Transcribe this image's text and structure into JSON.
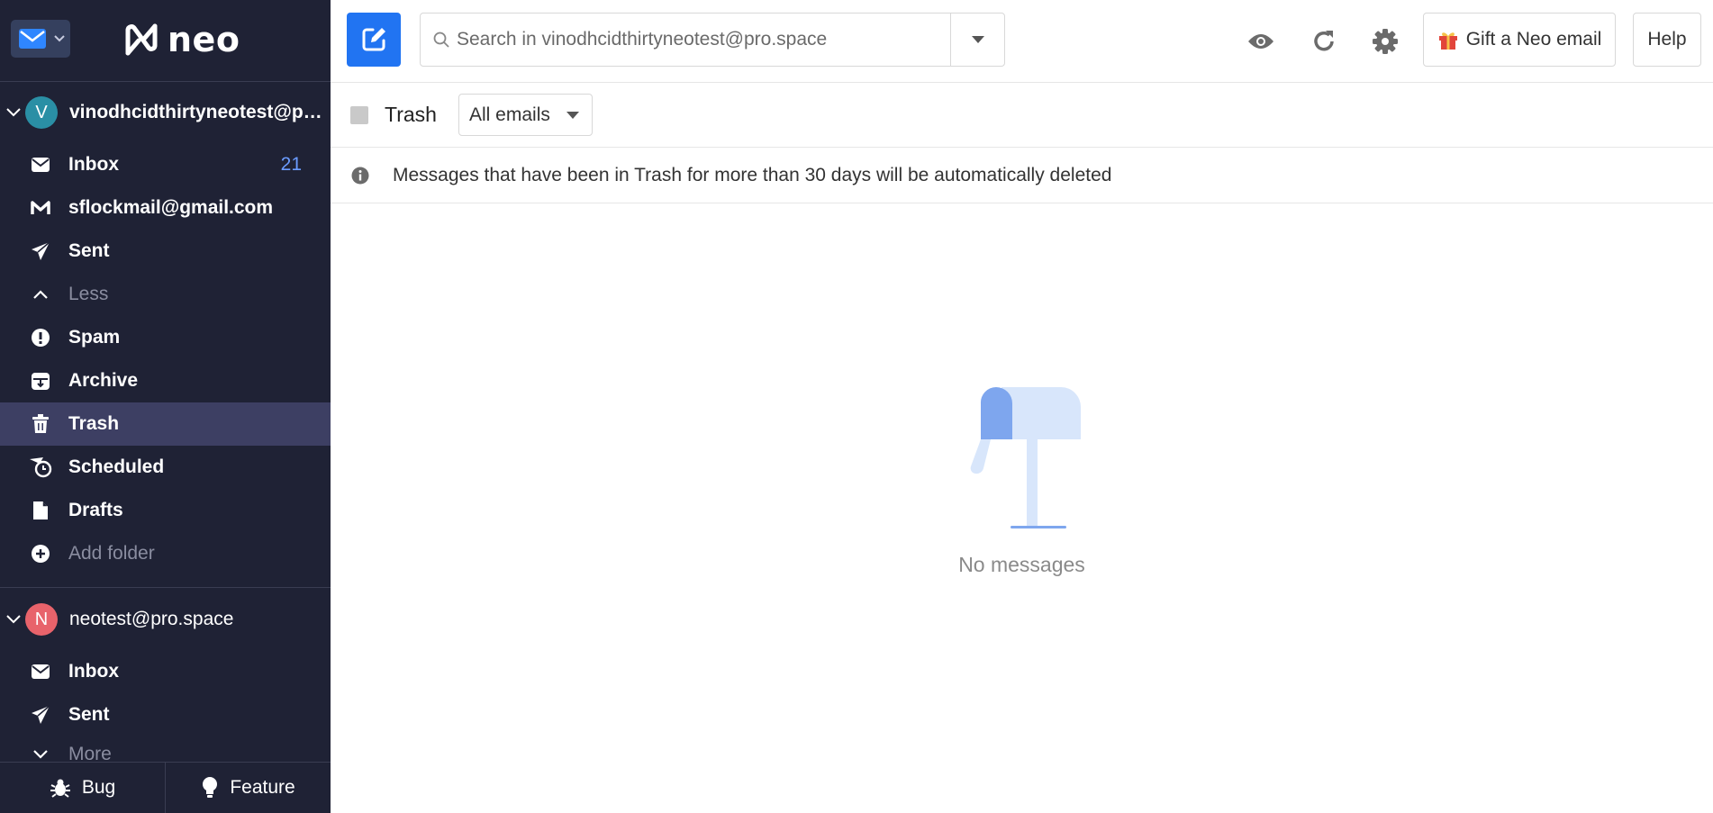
{
  "sidebar": {
    "brand": {
      "logo_text": "neo"
    },
    "accounts": [
      {
        "avatar_letter": "V",
        "avatar_color": "#2a8fa5",
        "email": "vinodhcidthirtyneotest@pro.space",
        "folders": [
          {
            "label": "Inbox",
            "icon": "envelope-icon",
            "count": "21"
          },
          {
            "label": "sflockmail@gmail.com",
            "icon": "gmail-icon",
            "count": ""
          },
          {
            "label": "Sent",
            "icon": "paper-plane-icon",
            "count": ""
          },
          {
            "label": "Less",
            "icon": "chevron-up-icon",
            "count": ""
          },
          {
            "label": "Spam",
            "icon": "exclamation-icon",
            "count": ""
          },
          {
            "label": "Archive",
            "icon": "archive-icon",
            "count": ""
          },
          {
            "label": "Trash",
            "icon": "trash-icon",
            "count": ""
          },
          {
            "label": "Scheduled",
            "icon": "scheduled-icon",
            "count": ""
          },
          {
            "label": "Drafts",
            "icon": "drafts-icon",
            "count": ""
          },
          {
            "label": "Add folder",
            "icon": "plus-circle-icon",
            "count": ""
          }
        ]
      },
      {
        "avatar_letter": "N",
        "avatar_color": "#e8636b",
        "email": "neotest@pro.space",
        "folders": [
          {
            "label": "Inbox",
            "icon": "envelope-icon"
          },
          {
            "label": "Sent",
            "icon": "paper-plane-icon"
          },
          {
            "label": "More",
            "icon": "chevron-down-icon"
          }
        ]
      }
    ],
    "bottom": {
      "bug_label": "Bug",
      "feature_label": "Feature"
    }
  },
  "toolbar": {
    "search_placeholder": "Search in vinodhcidthirtyneotest@pro.space",
    "gift_label": "Gift a Neo email",
    "help_label": "Help",
    "accent_color": "#2174f2"
  },
  "folder_view": {
    "title": "Trash",
    "filter_value": "All emails",
    "notice": "Messages that have been in Trash for more than 30 days will be automatically deleted",
    "empty_text": "No messages"
  }
}
